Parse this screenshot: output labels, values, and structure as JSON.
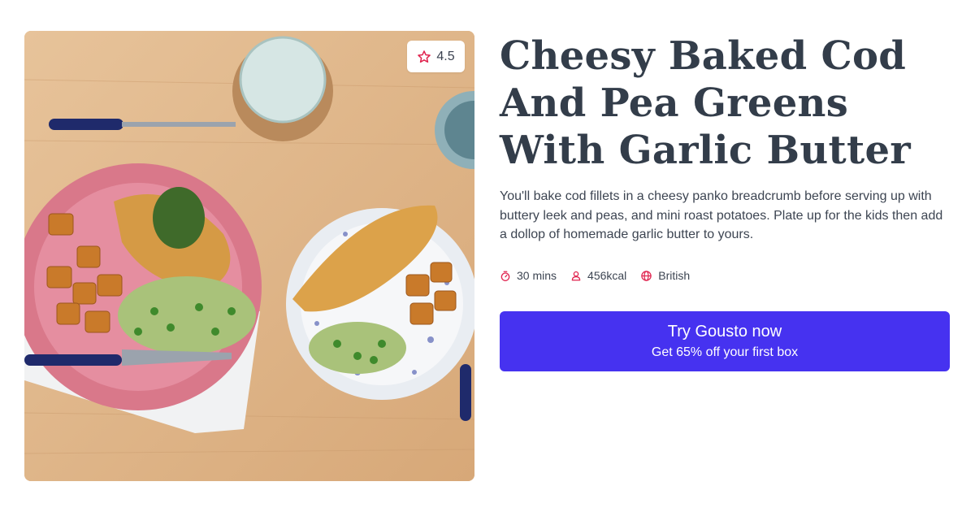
{
  "recipe": {
    "title": "Cheesy Baked Cod And Pea Greens With Garlic Butter",
    "description": "You'll bake cod fillets in a cheesy panko breadcrumb before serving up with buttery leek and peas, and mini roast potatoes. Plate up for the kids then add a dollop of homemade garlic butter to yours.",
    "rating": "4.5",
    "meta": {
      "time": "30 mins",
      "calories": "456kcal",
      "cuisine": "British"
    },
    "icons": {
      "rating": "star-outline-icon",
      "time": "stopwatch-icon",
      "calories": "person-icon",
      "cuisine": "globe-icon"
    }
  },
  "cta": {
    "label": "Try Gousto now",
    "sublabel": "Get 65% off your first box"
  },
  "colors": {
    "accent": "#4632f0",
    "icon_red": "#e0234e",
    "title": "#333d4a"
  }
}
